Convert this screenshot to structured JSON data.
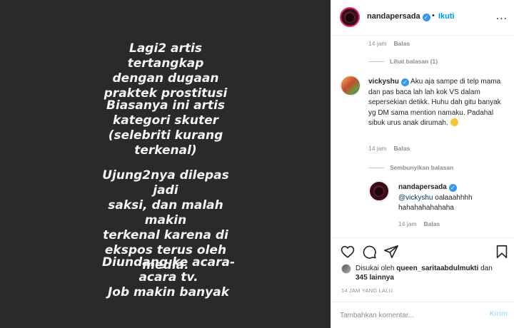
{
  "image_text": {
    "block1": "Lagi2 artis tertangkap\ndengan dugaan\npraktek prostitusi",
    "block2": "Biasanya ini artis\nkategori skuter\n(selebriti kurang\nterkenal)",
    "block3": "Ujung2nya dilepas jadi\nsaksi, dan malah makin\nterkenal karena di\nekspos terus oleh\nmedia.",
    "block4": "Diundang ke acara-\nacara tv.\nJob makin banyak"
  },
  "header": {
    "username": "nandapersada",
    "separator": "•",
    "follow_label": "Ikuti",
    "more_label": "..."
  },
  "thread": {
    "top_meta": {
      "time": "14 jam",
      "reply_label": "Balas"
    },
    "view_replies": "Lihat balasan (1)",
    "comment": {
      "username": "vickyshu",
      "text": "Aku aja sampe di telp mama dan pas baca lah lah kok VS dalam sepersekian detikk. Huhu dah gitu banyak yg DM sama mention namaku. Padahal sibuk urus anak dirumah.",
      "time": "14 jam",
      "reply_label": "Balas"
    },
    "hide_replies": "Sembunyikan balasan",
    "reply": {
      "username": "nandapersada",
      "mention": "@vickyshu",
      "text": " oalaaahhhh hahahahahahaha",
      "time": "14 jam",
      "reply_label": "Balas"
    }
  },
  "likes": {
    "prefix": "Disukai oleh ",
    "user": "queen_saritaabdulmukti",
    "middle": " dan",
    "count": "345 lainnya"
  },
  "timestamp": "14 JAM YANG LALU",
  "comment_box": {
    "placeholder": "Tambahkan komentar...",
    "post_label": "Kirim"
  },
  "colors": {
    "link_blue": "#0095f6",
    "verified_blue": "#3897f0",
    "image_background": "#2a2a2a",
    "muted_text": "#8e8e8e"
  },
  "icons": [
    "heart-icon",
    "comment-icon",
    "share-icon",
    "bookmark-icon",
    "verified-icon",
    "more-icon",
    "emoji-icon"
  ]
}
